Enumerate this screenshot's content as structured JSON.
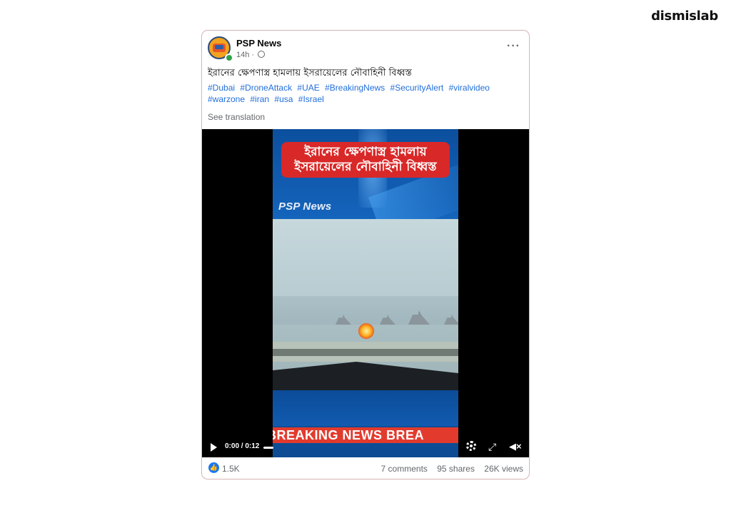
{
  "brand": "dismislab",
  "post": {
    "page_name": "PSP News",
    "time": "14h",
    "title": "ইরানের ক্ষেপণাস্ত্র হামলায় ইসরায়েলের নৌবাহিনী বিধ্বস্ত",
    "hashtags": [
      "#Dubai",
      "#DroneAttack",
      "#UAE",
      "#BreakingNews",
      "#SecurityAlert",
      "#viralvideo",
      "#warzone",
      "#iran",
      "#usa",
      "#Israel"
    ],
    "see_translation": "See translation"
  },
  "video": {
    "overlay_headline": "ইরানের ক্ষেপণাস্ত্র হামলায় ইসরায়েলের নৌবাহিনী বিধ্বস্ত",
    "watermark": "PSP News",
    "ticker": "BREAKING NEWS   BREA",
    "time_display": "0:00 / 0:12",
    "progress": 0
  },
  "footer": {
    "reactions": "1.5K",
    "comments": "7 comments",
    "shares": "95 shares",
    "views": "26K views"
  },
  "colors": {
    "accent": "#1877f2",
    "hashtag": "#216fdb",
    "headline_bg": "#d92828",
    "ticker_bg": "#e23b2e"
  }
}
